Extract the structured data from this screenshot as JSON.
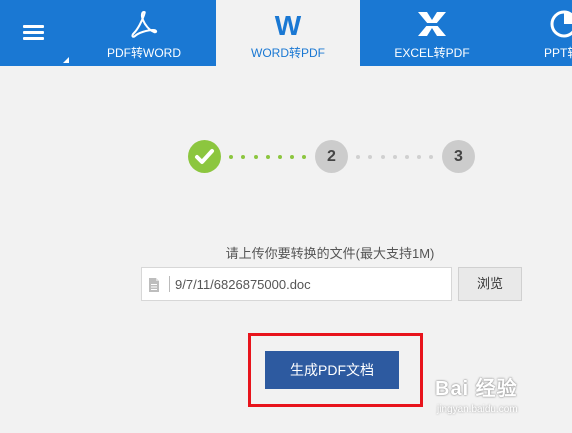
{
  "nav": {
    "tabs": [
      {
        "label": "PDF转WORD",
        "icon": "acrobat-icon"
      },
      {
        "label": "WORD转PDF",
        "icon": "word-icon",
        "active": true
      },
      {
        "label": "EXCEL转PDF",
        "icon": "excel-icon"
      },
      {
        "label": "PPT转PDF",
        "icon": "ppt-icon"
      }
    ]
  },
  "steps": {
    "done_icon": "check-icon",
    "items": [
      "2",
      "3"
    ]
  },
  "upload": {
    "hint": "请上传你要转换的文件(最大支持1M)",
    "file_value": "9/7/11/6826875000.doc",
    "browse_label": "浏览"
  },
  "generate": {
    "label": "生成PDF文档"
  },
  "watermark": {
    "main": "Bai 经验",
    "sub": "jingyan.baidu.com"
  },
  "colors": {
    "nav_bg": "#1a78d3",
    "step_done": "#8cc63f",
    "step_pending": "#cccccc",
    "primary_button": "#2d5aa0",
    "highlight": "#e8141c"
  }
}
